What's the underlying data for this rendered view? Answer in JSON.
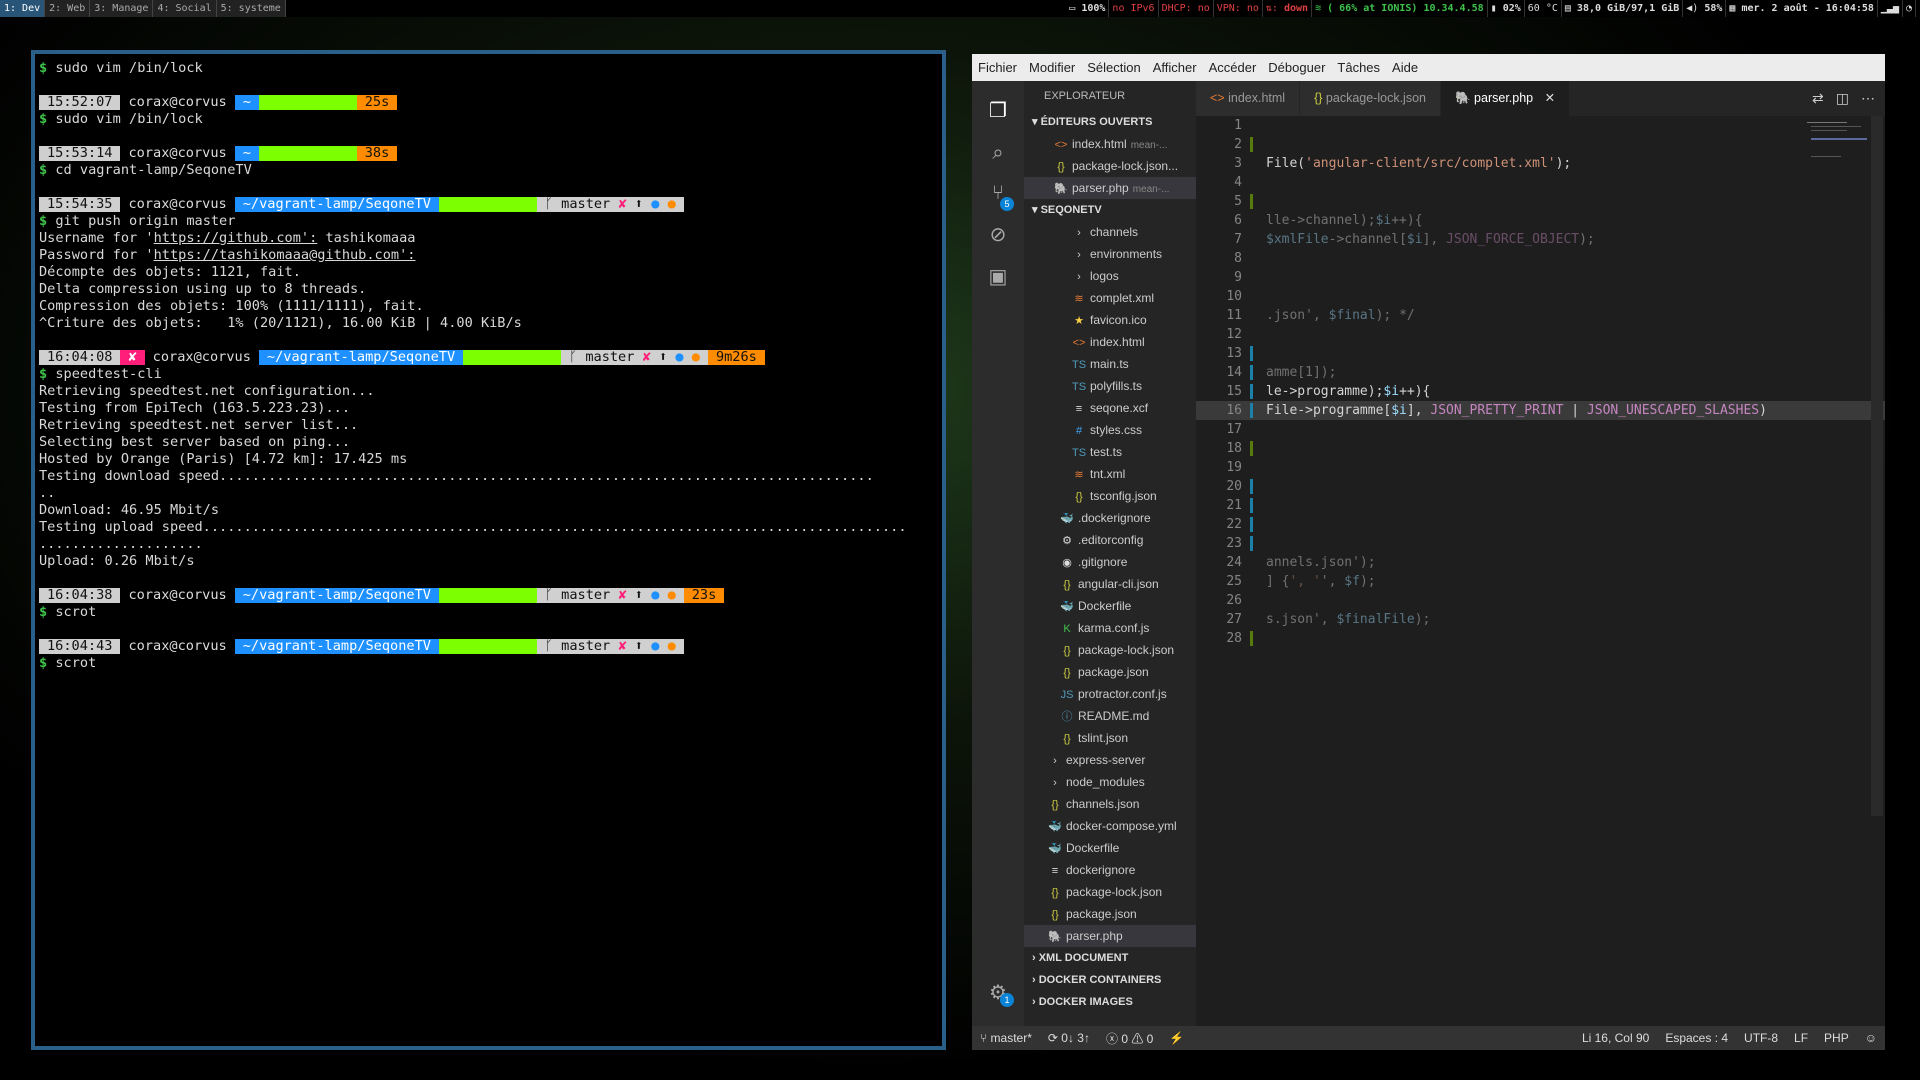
{
  "workspaces": [
    "1: Dev",
    "2: Web",
    "3: Manage",
    "4: Social",
    "5: systeme"
  ],
  "status": {
    "battery": "100%",
    "ipv6": "no IPv6",
    "dhcp": "DHCP: no",
    "vpn": "VPN: no",
    "eth": "down",
    "wifi": "( 66% at IONIS) 10.34.4.58",
    "cpu": "02%",
    "temp": "60 °C",
    "disk": "38,0 GiB/97,1 GiB",
    "volume": "58%",
    "date": "mer.  2 août - 16:04:58"
  },
  "terminal": {
    "lines": [
      {
        "kind": "cmd",
        "text": "sudo vim /bin/lock"
      },
      {
        "kind": "gap"
      },
      {
        "kind": "prompt",
        "time": "15:52:07",
        "user": "corax@corvus",
        "dir": "~",
        "git": false,
        "dur": "25s"
      },
      {
        "kind": "cmd",
        "text": "sudo vim /bin/lock"
      },
      {
        "kind": "gap"
      },
      {
        "kind": "prompt",
        "time": "15:53:14",
        "user": "corax@corvus",
        "dir": "~",
        "git": false,
        "dur": "38s"
      },
      {
        "kind": "cmd",
        "text": "cd vagrant-lamp/SeqoneTV"
      },
      {
        "kind": "gap"
      },
      {
        "kind": "prompt",
        "time": "15:54:35",
        "user": "corax@corvus",
        "dir": "~/vagrant-lamp/SeqoneTV",
        "git": true,
        "branch": "master",
        "dur": ""
      },
      {
        "kind": "cmd",
        "text": "git push origin master"
      },
      {
        "kind": "out",
        "text": "Username for 'https://github.com': tashikomaaa"
      },
      {
        "kind": "out",
        "text": "Password for 'https://tashikomaaa@github.com':"
      },
      {
        "kind": "out",
        "text": "Décompte des objets: 1121, fait."
      },
      {
        "kind": "out",
        "text": "Delta compression using up to 8 threads."
      },
      {
        "kind": "out",
        "text": "Compression des objets: 100% (1111/1111), fait."
      },
      {
        "kind": "out",
        "text": "^Criture des objets:   1% (20/1121), 16.00 KiB | 4.00 KiB/s"
      },
      {
        "kind": "gap"
      },
      {
        "kind": "prompt",
        "time": "16:04:08",
        "err": "✘",
        "user": "corax@corvus",
        "dir": "~/vagrant-lamp/SeqoneTV",
        "git": true,
        "branch": "master",
        "dur": "9m26s"
      },
      {
        "kind": "cmd",
        "text": "speedtest-cli"
      },
      {
        "kind": "out",
        "text": "Retrieving speedtest.net configuration..."
      },
      {
        "kind": "out",
        "text": "Testing from EpiTech (163.5.223.23)..."
      },
      {
        "kind": "out",
        "text": "Retrieving speedtest.net server list..."
      },
      {
        "kind": "out",
        "text": "Selecting best server based on ping..."
      },
      {
        "kind": "out",
        "text": "Hosted by Orange (Paris) [4.72 km]: 17.425 ms"
      },
      {
        "kind": "out",
        "text": "Testing download speed................................................................................"
      },
      {
        "kind": "out",
        "text": ".."
      },
      {
        "kind": "out",
        "text": "Download: 46.95 Mbit/s"
      },
      {
        "kind": "out",
        "text": "Testing upload speed......................................................................................"
      },
      {
        "kind": "out",
        "text": "...................."
      },
      {
        "kind": "out",
        "text": "Upload: 0.26 Mbit/s"
      },
      {
        "kind": "gap"
      },
      {
        "kind": "prompt",
        "time": "16:04:38",
        "user": "corax@corvus",
        "dir": "~/vagrant-lamp/SeqoneTV",
        "git": true,
        "branch": "master",
        "dur": "23s"
      },
      {
        "kind": "cmd",
        "text": "scrot"
      },
      {
        "kind": "gap"
      },
      {
        "kind": "prompt",
        "time": "16:04:43",
        "user": "corax@corvus",
        "dir": "~/vagrant-lamp/SeqoneTV",
        "git": true,
        "branch": "master",
        "dur": ""
      },
      {
        "kind": "cmd",
        "text": "scrot"
      }
    ]
  },
  "vscode": {
    "menu": [
      "Fichier",
      "Modifier",
      "Sélection",
      "Afficher",
      "Accéder",
      "Déboguer",
      "Tâches",
      "Aide"
    ],
    "explorer_title": "EXPLORATEUR",
    "scm_badge": "5",
    "settings_badge": "1",
    "open_editors_title": "ÉDITEURS OUVERTS",
    "open_editors": [
      {
        "icon": "<>",
        "cls": "c-html",
        "name": "index.html",
        "sub": "mean-..."
      },
      {
        "icon": "{}",
        "cls": "c-json",
        "name": "package-lock.json..."
      },
      {
        "icon": "🐘",
        "cls": "c-php",
        "name": "parser.php",
        "sub": "mean-...",
        "sel": true
      }
    ],
    "project_title": "SEQONETV",
    "tree": [
      {
        "indent": 3,
        "folder": true,
        "name": "channels"
      },
      {
        "indent": 3,
        "folder": true,
        "name": "environments"
      },
      {
        "indent": 3,
        "folder": true,
        "name": "logos"
      },
      {
        "indent": 3,
        "icon": "≋",
        "cls": "c-xml",
        "name": "complet.xml"
      },
      {
        "indent": 3,
        "icon": "★",
        "cls": "c-star",
        "name": "favicon.ico"
      },
      {
        "indent": 3,
        "icon": "<>",
        "cls": "c-html",
        "name": "index.html"
      },
      {
        "indent": 3,
        "icon": "TS",
        "cls": "c-ts",
        "name": "main.ts"
      },
      {
        "indent": 3,
        "icon": "TS",
        "cls": "c-ts",
        "name": "polyfills.ts"
      },
      {
        "indent": 3,
        "icon": "≡",
        "cls": "c-git",
        "name": "seqone.xcf"
      },
      {
        "indent": 3,
        "icon": "#",
        "cls": "c-css",
        "name": "styles.css"
      },
      {
        "indent": 3,
        "icon": "TS",
        "cls": "c-ts",
        "name": "test.ts"
      },
      {
        "indent": 3,
        "icon": "≋",
        "cls": "c-xml",
        "name": "tnt.xml"
      },
      {
        "indent": 3,
        "icon": "{}",
        "cls": "c-json",
        "name": "tsconfig.json"
      },
      {
        "indent": 2,
        "icon": "🐳",
        "cls": "c-dock",
        "name": ".dockerignore"
      },
      {
        "indent": 2,
        "icon": "⚙",
        "cls": "c-git",
        "name": ".editorconfig"
      },
      {
        "indent": 2,
        "icon": "◉",
        "cls": "c-git",
        "name": ".gitignore"
      },
      {
        "indent": 2,
        "icon": "{}",
        "cls": "c-json",
        "name": "angular-cli.json"
      },
      {
        "indent": 2,
        "icon": "🐳",
        "cls": "c-dock",
        "name": "Dockerfile"
      },
      {
        "indent": 2,
        "icon": "K",
        "cls": "c-karma",
        "name": "karma.conf.js"
      },
      {
        "indent": 2,
        "icon": "{}",
        "cls": "c-json",
        "name": "package-lock.json"
      },
      {
        "indent": 2,
        "icon": "{}",
        "cls": "c-json",
        "name": "package.json"
      },
      {
        "indent": 2,
        "icon": "JS",
        "cls": "c-ts",
        "name": "protractor.conf.js"
      },
      {
        "indent": 2,
        "icon": "ⓘ",
        "cls": "c-info",
        "name": "README.md"
      },
      {
        "indent": 2,
        "icon": "{}",
        "cls": "c-json",
        "name": "tslint.json"
      },
      {
        "indent": 1,
        "folder": true,
        "name": "express-server"
      },
      {
        "indent": 1,
        "folder": true,
        "name": "node_modules"
      },
      {
        "indent": 1,
        "icon": "{}",
        "cls": "c-json",
        "name": "channels.json"
      },
      {
        "indent": 1,
        "icon": "🐳",
        "cls": "c-dock",
        "name": "docker-compose.yml"
      },
      {
        "indent": 1,
        "icon": "🐳",
        "cls": "c-dock",
        "name": "Dockerfile"
      },
      {
        "indent": 1,
        "icon": "≡",
        "cls": "c-git",
        "name": "dockerignore"
      },
      {
        "indent": 1,
        "icon": "{}",
        "cls": "c-json",
        "name": "package-lock.json"
      },
      {
        "indent": 1,
        "icon": "{}",
        "cls": "c-json",
        "name": "package.json"
      },
      {
        "indent": 1,
        "icon": "🐘",
        "cls": "c-php",
        "name": "parser.php",
        "sel": true
      }
    ],
    "bottom_sections": [
      "XML DOCUMENT",
      "DOCKER CONTAINERS",
      "DOCKER IMAGES"
    ],
    "tabs": [
      {
        "icon": "<>",
        "cls": "c-html",
        "name": "index.html"
      },
      {
        "icon": "{}",
        "cls": "c-json",
        "name": "package-lock.json"
      },
      {
        "icon": "🐘",
        "cls": "c-php",
        "name": "parser.php",
        "active": true
      }
    ],
    "code_lines": [
      "",
      "",
      "File('angular-client/src/complet.xml');",
      "",
      "",
      "lle->channel);$i++){",
      "$xmlFile->channel[$i], JSON_FORCE_OBJECT);",
      "",
      "",
      "",
      ".json', $final); */",
      "",
      "",
      "amme[1]);",
      "le->programme);$i++){",
      "File->programme[$i], JSON_PRETTY_PRINT | JSON_UNESCAPED_SLASHES)",
      "",
      "",
      "",
      "",
      "",
      "",
      "",
      "annels.json');",
      "] {', '', $f);",
      "",
      "s.json', $finalFile);",
      ""
    ],
    "status": {
      "branch": "master*",
      "sync": "0↓ 3↑",
      "errors": "0",
      "warnings": "0",
      "position": "Li 16, Col 90",
      "spaces": "Espaces : 4",
      "encoding": "UTF-8",
      "eol": "LF",
      "language": "PHP"
    }
  }
}
